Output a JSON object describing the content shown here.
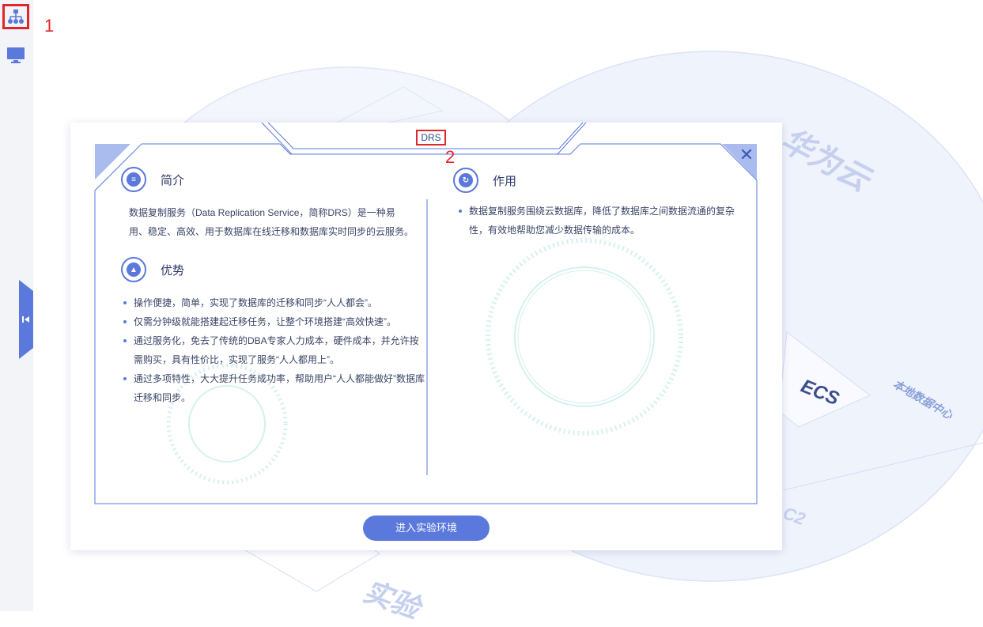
{
  "annotations": {
    "marker_1": "1",
    "marker_2": "2"
  },
  "background": {
    "brand_text": "华为云",
    "ecs_label": "ECS",
    "datacenter_label": "本地数据中心",
    "bottom_text": "实验",
    "c2_text": "C2"
  },
  "modal": {
    "title": "DRS",
    "intro": {
      "heading": "简介",
      "text": "数据复制服务（Data Replication Service，简称DRS）是一种易用、稳定、高效、用于数据库在线迁移和数据库实时同步的云服务。"
    },
    "advantages": {
      "heading": "优势",
      "items": [
        "操作便捷，简单，实现了数据库的迁移和同步“人人都会”。",
        "仅需分钟级就能搭建起迁移任务，让整个环境搭建“高效快速”。",
        "通过服务化，免去了传统的DBA专家人力成本，硬件成本，并允许按需购买，具有性价比，实现了服务“人人都用上”。",
        "通过多项特性，大大提升任务成功率，帮助用户“人人都能做好”数据库迁移和同步。"
      ]
    },
    "usage": {
      "heading": "作用",
      "items": [
        "数据复制服务围绕云数据库，降低了数据库之间数据流通的复杂性，有效地帮助您减少数据传输的成本。"
      ]
    },
    "enter_button": "进入实验环境"
  },
  "colors": {
    "accent": "#5b78dc",
    "highlight": "#e0262b",
    "text": "#3a4566"
  },
  "icons": {
    "rail_topology": "topology-icon",
    "rail_desktop": "desktop-icon",
    "collapse": "collapse-left-icon",
    "close": "close-icon"
  }
}
